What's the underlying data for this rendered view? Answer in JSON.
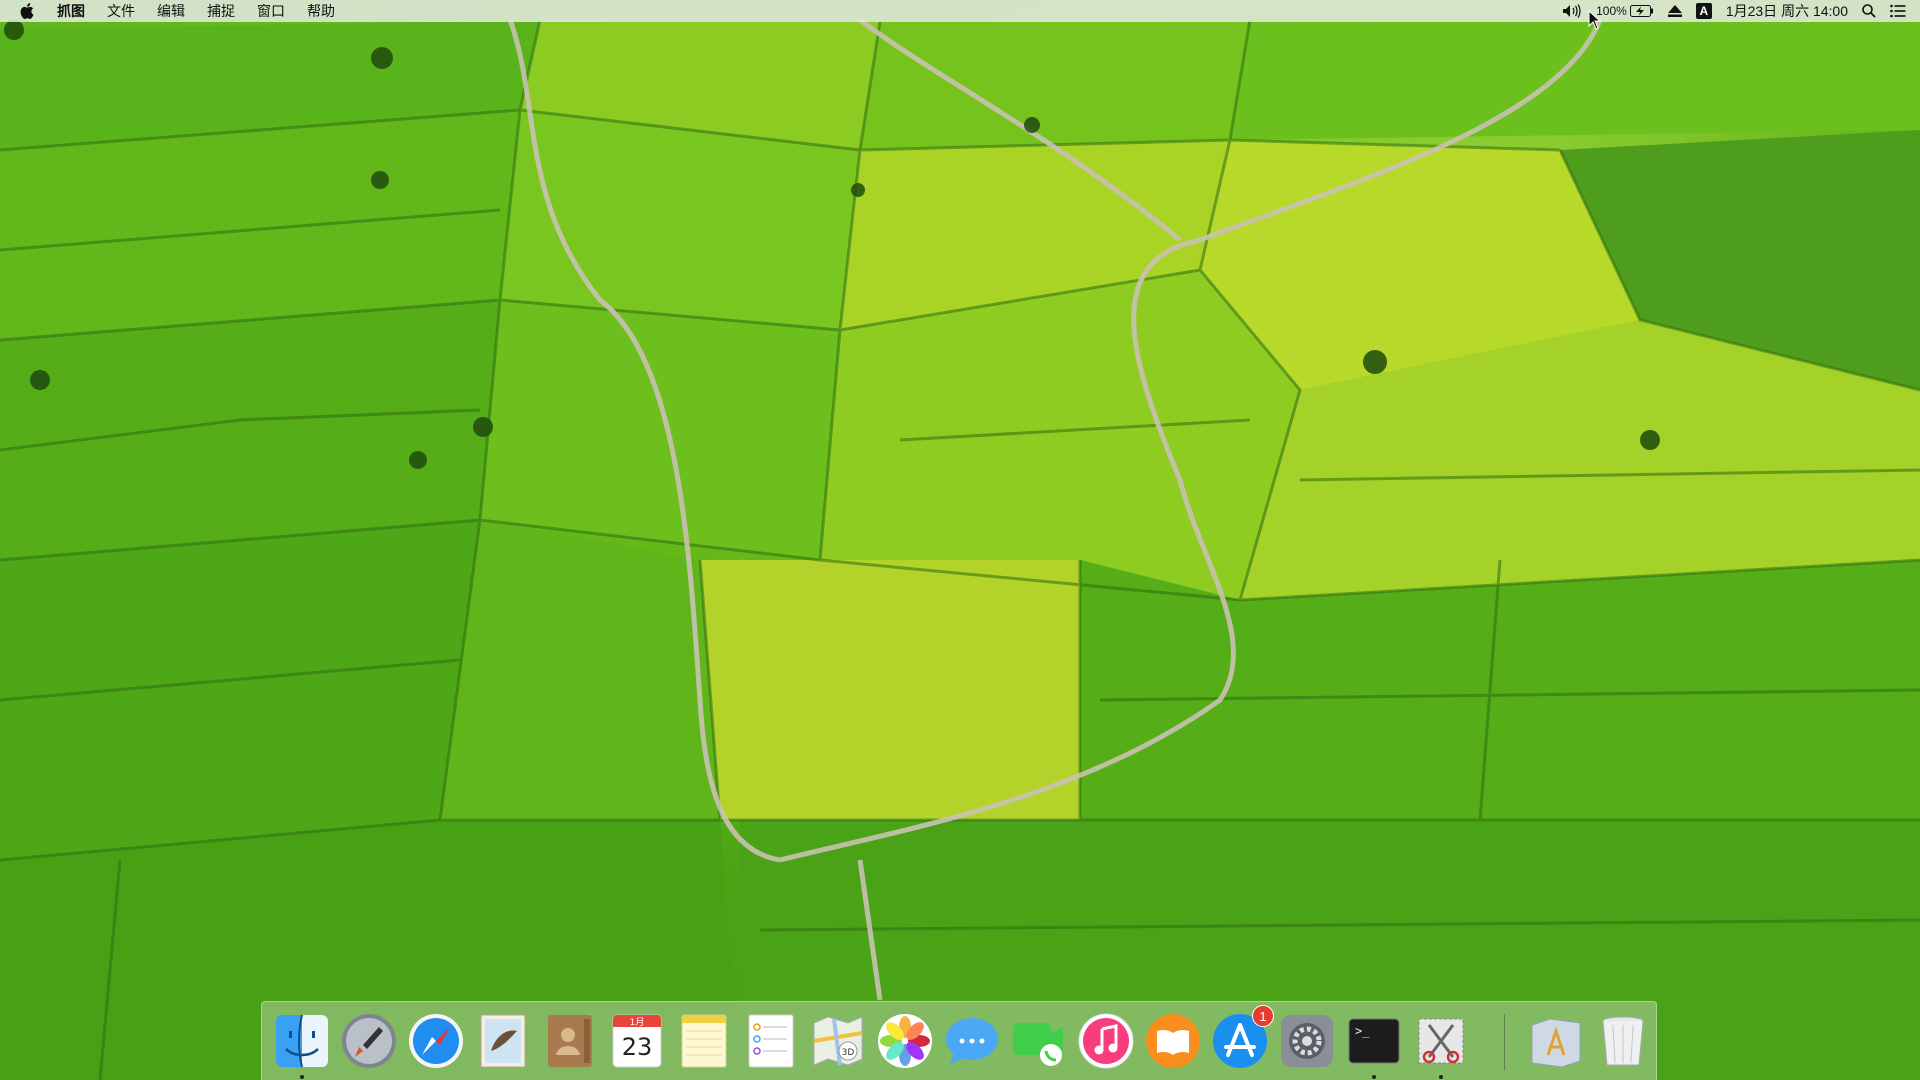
{
  "menubar": {
    "app_menus": [
      "抓图",
      "文件",
      "编辑",
      "捕捉",
      "窗口",
      "帮助"
    ],
    "status": {
      "battery_percent": "100%",
      "input_method": "A",
      "datetime": "1月23日 周六 14:00"
    }
  },
  "dock": {
    "apps": [
      {
        "name": "Finder",
        "icon": "finder-icon",
        "running": true
      },
      {
        "name": "Launchpad",
        "icon": "launchpad-icon",
        "running": false
      },
      {
        "name": "Safari",
        "icon": "safari-icon",
        "running": false
      },
      {
        "name": "Mail",
        "icon": "mail-icon",
        "running": false
      },
      {
        "name": "Contacts",
        "icon": "contacts-icon",
        "running": false
      },
      {
        "name": "Calendar",
        "icon": "calendar-icon",
        "running": false,
        "month": "1月",
        "day": "23"
      },
      {
        "name": "Notes",
        "icon": "notes-icon",
        "running": false
      },
      {
        "name": "Reminders",
        "icon": "reminders-icon",
        "running": false
      },
      {
        "name": "Maps",
        "icon": "maps-icon",
        "running": false
      },
      {
        "name": "Photos",
        "icon": "photos-icon",
        "running": false
      },
      {
        "name": "Messages",
        "icon": "messages-icon",
        "running": false
      },
      {
        "name": "FaceTime",
        "icon": "facetime-icon",
        "running": false
      },
      {
        "name": "iTunes",
        "icon": "itunes-icon",
        "running": false
      },
      {
        "name": "iBooks",
        "icon": "ibooks-icon",
        "running": false
      },
      {
        "name": "App Store",
        "icon": "app-store-icon",
        "running": false,
        "badge": "1"
      },
      {
        "name": "System Preferences",
        "icon": "system-preferences-icon",
        "running": false
      },
      {
        "name": "Terminal",
        "icon": "terminal-icon",
        "running": true,
        "prompt": ">_"
      },
      {
        "name": "Grab",
        "icon": "grab-icon",
        "running": true
      }
    ],
    "others": [
      {
        "name": "Applications",
        "icon": "applications-folder-icon"
      },
      {
        "name": "Trash",
        "icon": "trash-icon"
      }
    ]
  },
  "colors": {
    "field_green": "#5fb51c",
    "field_yellow": "#b9d82a",
    "road": "#c9c2b1"
  }
}
